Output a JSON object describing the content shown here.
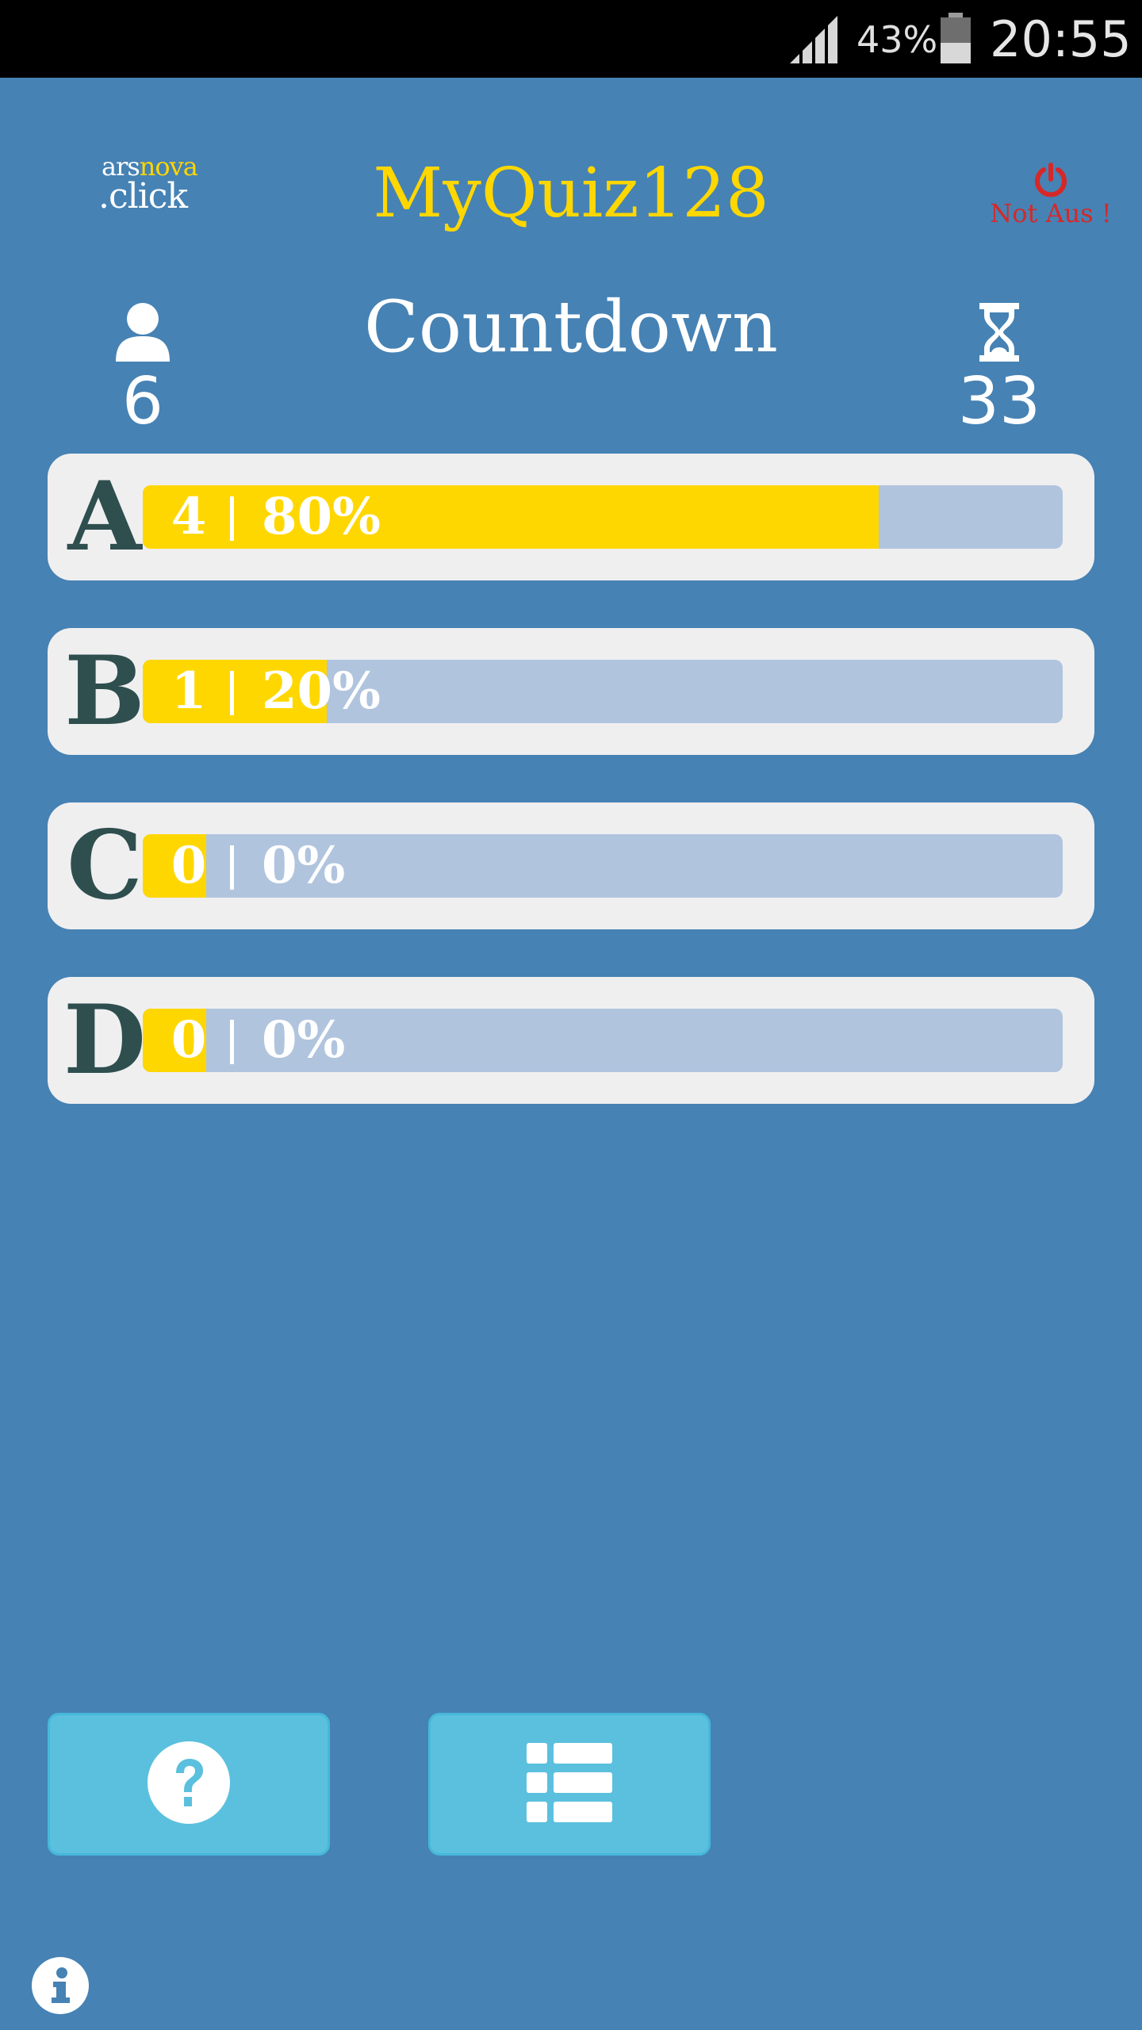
{
  "status_bar": {
    "battery_percent": "43%",
    "time": "20:55",
    "signal_icon": "signal-icon",
    "battery_icon": "battery-icon",
    "battery_level": 0.43
  },
  "header": {
    "logo_top_part1": "ars",
    "logo_top_part2": "nova",
    "logo_bottom": ".click",
    "title": "MyQuiz128",
    "power_label": "Not Aus !",
    "power_icon": "power-icon",
    "colors": {
      "title": "#ffd700",
      "power": "#d62828",
      "background": "#4682b4"
    }
  },
  "session": {
    "mode": "Countdown",
    "participants": "6",
    "seconds_left": "33",
    "participants_icon": "user-icon",
    "timer_icon": "hourglass-icon"
  },
  "answers": [
    {
      "letter": "A",
      "count": "4",
      "percent_label": "80%",
      "fill": 0.8
    },
    {
      "letter": "B",
      "count": "1",
      "percent_label": "20%",
      "fill": 0.2
    },
    {
      "letter": "C",
      "count": "0",
      "percent_label": "0%",
      "fill": 0.0
    },
    {
      "letter": "D",
      "count": "0",
      "percent_label": "0%",
      "fill": 0.0
    }
  ],
  "bar_colors": {
    "fill": "#ffd700",
    "track": "#b0c4de"
  },
  "footer": {
    "help_icon": "question-circle-icon",
    "list_icon": "list-icon",
    "info_icon": "info-icon"
  }
}
